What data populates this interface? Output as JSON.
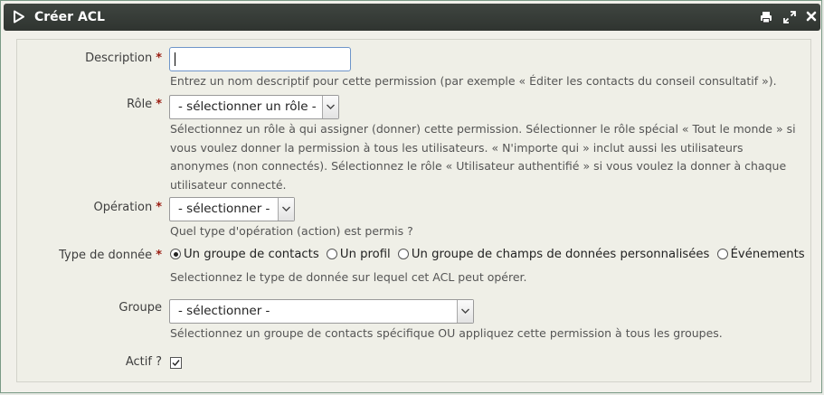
{
  "window": {
    "title": "Créer ACL"
  },
  "form": {
    "description": {
      "label": "Description",
      "required_mark": "*",
      "value": "",
      "help": "Entrez un nom descriptif pour cette permission (par exemple « Éditer les contacts du conseil consultatif »)."
    },
    "role": {
      "label": "Rôle",
      "required_mark": "*",
      "selected": "- sélectionner un rôle -",
      "help_lines": [
        "Sélectionnez un rôle à qui assigner (donner) cette permission. Sélectionner le rôle spécial « Tout le monde » si",
        "vous voulez donner la permission à tous les utilisateurs. « N'importe qui » inclut aussi les utilisateurs",
        "anonymes (non connectés). Sélectionnez le rôle « Utilisateur authentifié » si vous voulez la donner à chaque",
        "utilisateur connecté."
      ]
    },
    "operation": {
      "label": "Opération",
      "required_mark": "*",
      "selected": "- sélectionner -",
      "help": "Quel type d'opération (action) est permis ?"
    },
    "data_type": {
      "label": "Type de donnée",
      "required_mark": "*",
      "options": [
        {
          "label": "Un groupe de contacts",
          "checked": true
        },
        {
          "label": "Un profil",
          "checked": false
        },
        {
          "label": "Un groupe de champs de données personnalisées",
          "checked": false
        },
        {
          "label": "Événements",
          "checked": false
        }
      ],
      "help": "Selectionnez le type de donnée sur lequel cet ACL peut opérer."
    },
    "group": {
      "label": "Groupe",
      "selected": "- sélectionner -",
      "help": "Sélectionnez un groupe de contacts spécifique OU appliquez cette permission à tous les groupes."
    },
    "active": {
      "label": "Actif ?",
      "checked": true
    }
  }
}
